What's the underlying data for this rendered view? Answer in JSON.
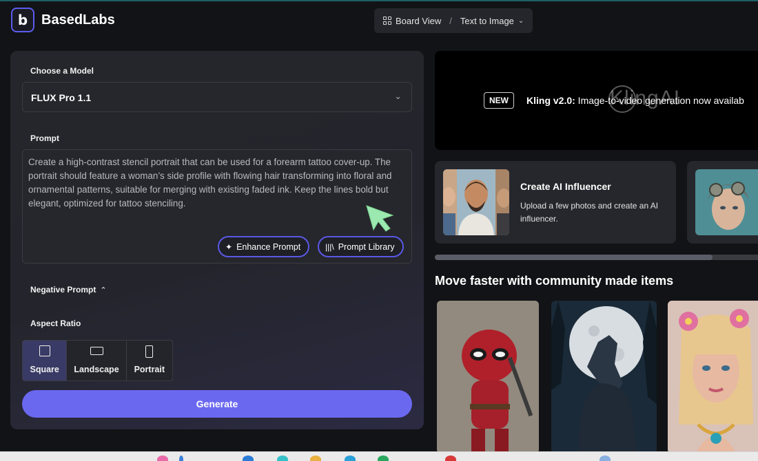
{
  "app": {
    "brand": "BasedLabs",
    "logo_glyph": "b"
  },
  "header": {
    "view_label": "Board View",
    "separator": "/",
    "mode_label": "Text to Image"
  },
  "form": {
    "model_label": "Choose a Model",
    "model_value": "FLUX Pro 1.1",
    "prompt_label": "Prompt",
    "prompt_text": "Create a high-contrast stencil portrait that can be used for a forearm tattoo cover-up. The portrait should feature a woman’s side profile with flowing hair transforming into floral and ornamental patterns, suitable for merging with existing faded ink. Keep the lines bold but elegant, optimized for tattoo stenciling.",
    "enhance_label": "Enhance Prompt",
    "library_label": "Prompt Library",
    "negative_label": "Negative Prompt",
    "aspect_label": "Aspect Ratio",
    "aspect_options": [
      {
        "label": "Square",
        "selected": true
      },
      {
        "label": "Landscape",
        "selected": false
      },
      {
        "label": "Portrait",
        "selected": false
      }
    ],
    "generate_label": "Generate"
  },
  "banner": {
    "badge": "NEW",
    "title_bold": "Kling v2.0:",
    "title_rest": " Image-to-video generation now availab",
    "watermark": "KlingAI"
  },
  "cards": [
    {
      "title": "Create AI Influencer",
      "description": "Upload a few photos and create an AI influencer."
    }
  ],
  "community": {
    "title": "Move faster with community made items"
  },
  "colors": {
    "accent": "#6b68f0",
    "panel": "#25262b",
    "background": "#121316"
  }
}
